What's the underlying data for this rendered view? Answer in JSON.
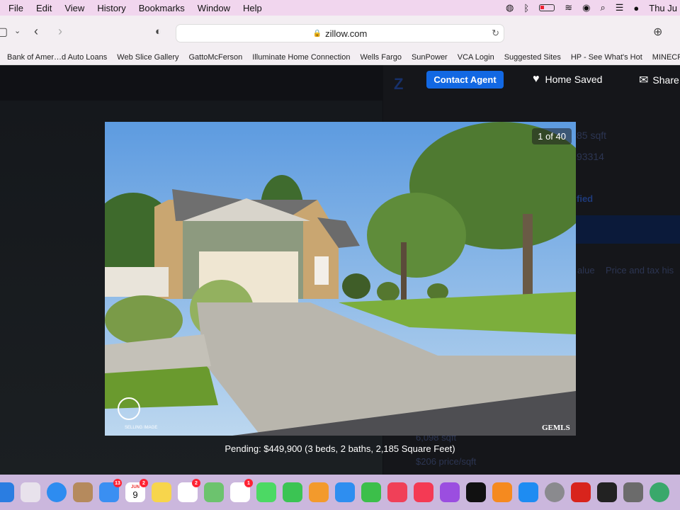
{
  "menubar": {
    "items": [
      "File",
      "Edit",
      "View",
      "History",
      "Bookmarks",
      "Window",
      "Help"
    ],
    "clock": "Thu Ju"
  },
  "browser": {
    "url": "zillow.com"
  },
  "bookmarks": [
    "Bank of Amer…d Auto Loans",
    "Web Slice Gallery",
    "GattoMcFerson",
    "Illuminate Home Connection",
    "Wells Fargo",
    "SunPower",
    "VCA Login",
    "Suggested Sites",
    "HP - See What's Hot",
    "MINECRAFT"
  ],
  "header": {
    "contact_agent": "Contact Agent",
    "home_saved": "Home Saved",
    "share": "Share"
  },
  "background": {
    "sqft_partial": "85 sqft",
    "zip_partial": "93314",
    "verified_partial": "fied",
    "tabs": [
      "alue",
      "Price and tax his"
    ],
    "lot_partial": "6,098 sqft",
    "price_per_sqft": "$206 price/sqft"
  },
  "photo": {
    "counter": "1 of 40",
    "caption": "Pending: $449,900 (3 beds, 2 baths, 2,185 Square Feet)",
    "watermark_left": "SELLING IMAGE",
    "watermark_right": "GEMLS"
  },
  "dock": {
    "mail_badge": "13",
    "calendar_month": "JUN",
    "calendar_day": "9",
    "calendar_badge": "2",
    "reminders_badge": "2",
    "photos_badge": "1"
  }
}
